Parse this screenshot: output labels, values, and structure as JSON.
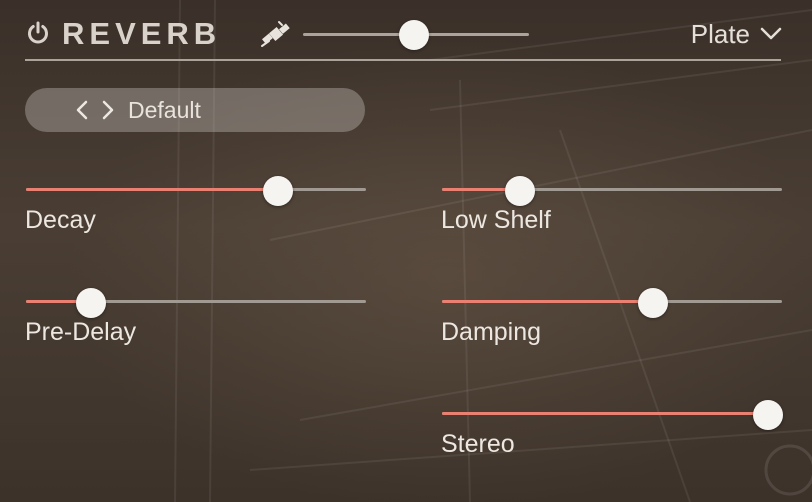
{
  "header": {
    "title": "REVERB",
    "power_icon": "power-icon",
    "mix_icon": "satellite-icon",
    "mix_level": 0.49,
    "type": {
      "selected": "Plate",
      "icon": "chevron-down-icon"
    }
  },
  "preset": {
    "name": "Default",
    "prev_icon": "chevron-left-icon",
    "next_icon": "chevron-right-icon"
  },
  "params": {
    "decay": {
      "label": "Decay",
      "value": 0.74
    },
    "low_shelf": {
      "label": "Low Shelf",
      "value": 0.23
    },
    "pre_delay": {
      "label": "Pre-Delay",
      "value": 0.19
    },
    "damping": {
      "label": "Damping",
      "value": 0.62
    },
    "stereo": {
      "label": "Stereo",
      "value": 0.96
    }
  },
  "colors": {
    "accent": "#e98072",
    "track": "#a19a93",
    "thumb": "#f6f4f1",
    "text": "#ece7e1"
  }
}
